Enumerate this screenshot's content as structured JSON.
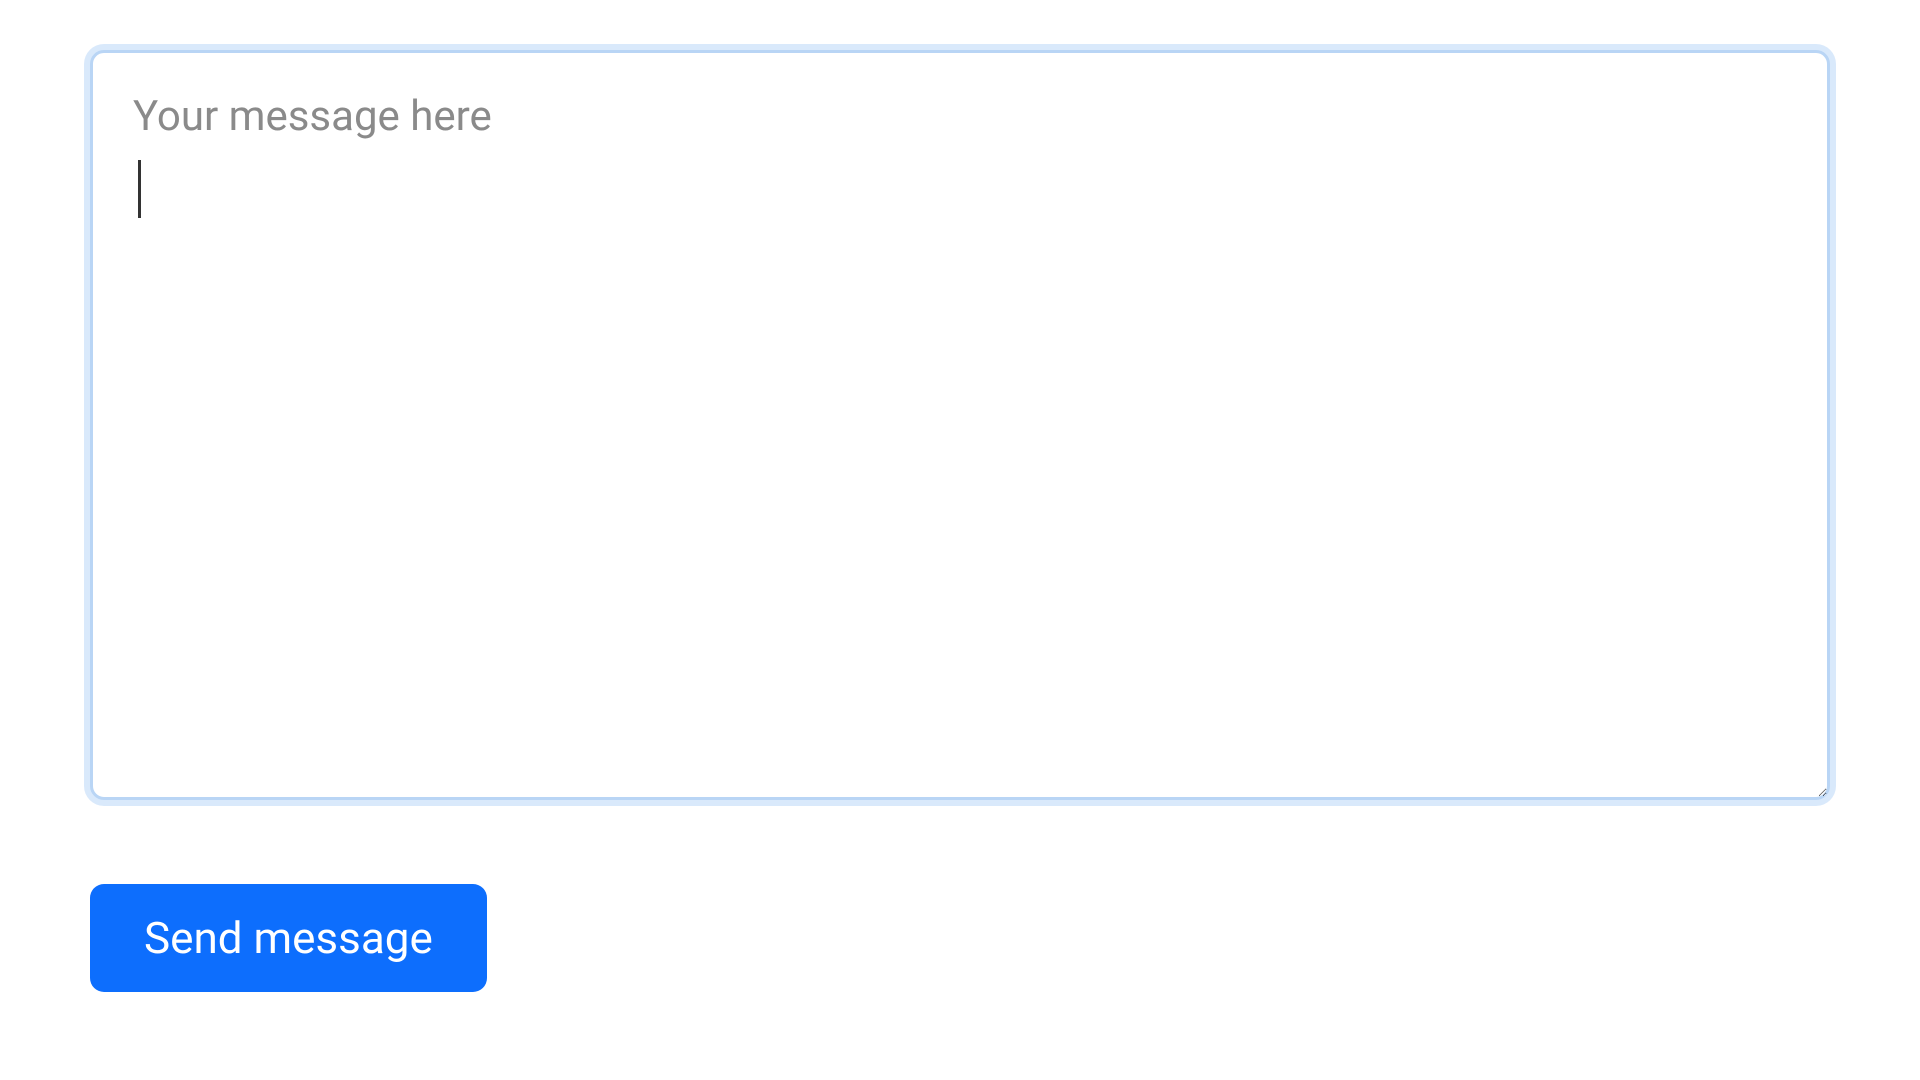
{
  "form": {
    "message_placeholder": "Your message here",
    "message_value": "",
    "send_label": "Send message"
  },
  "colors": {
    "button_bg": "#0d6efd",
    "button_text": "#ffffff",
    "textarea_border": "#b9d5f5",
    "textarea_glow": "rgba(160,200,245,0.4)",
    "placeholder": "#8a8a8a"
  }
}
